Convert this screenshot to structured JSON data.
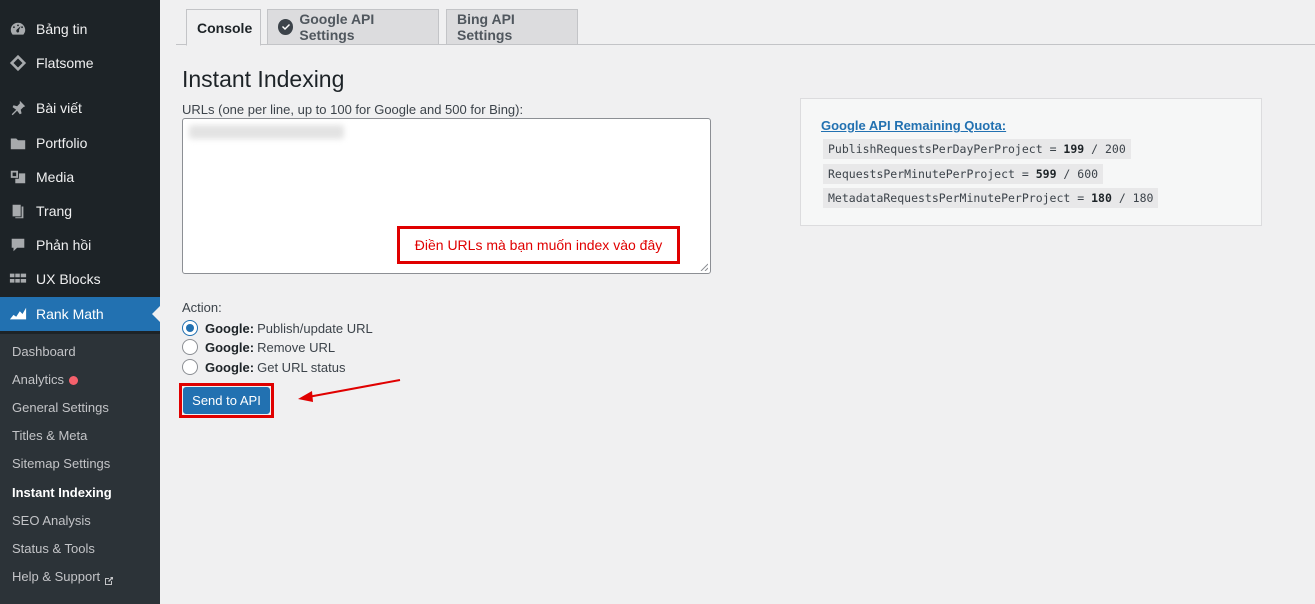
{
  "sidebar": {
    "items": [
      {
        "label": "Bảng tin",
        "icon": "dashboard-icon"
      },
      {
        "label": "Flatsome",
        "icon": "flatsome-icon"
      },
      {
        "label": "Bài viết",
        "icon": "pin-icon"
      },
      {
        "label": "Portfolio",
        "icon": "portfolio-icon"
      },
      {
        "label": "Media",
        "icon": "media-icon"
      },
      {
        "label": "Trang",
        "icon": "page-icon"
      },
      {
        "label": "Phản hồi",
        "icon": "comments-icon"
      },
      {
        "label": "UX Blocks",
        "icon": "blocks-icon"
      },
      {
        "label": "Rank Math",
        "icon": "rank-math-icon"
      }
    ],
    "submenu": [
      {
        "label": "Dashboard"
      },
      {
        "label": "Analytics"
      },
      {
        "label": "General Settings"
      },
      {
        "label": "Titles & Meta"
      },
      {
        "label": "Sitemap Settings"
      },
      {
        "label": "Instant Indexing"
      },
      {
        "label": "SEO Analysis"
      },
      {
        "label": "Status & Tools"
      },
      {
        "label": "Help & Support"
      }
    ],
    "active_color": "#2271b1"
  },
  "tabs": [
    {
      "label": "Console"
    },
    {
      "label": "Google API Settings"
    },
    {
      "label": "Bing API Settings"
    }
  ],
  "main": {
    "title": "Instant Indexing",
    "urls_label": "URLs (one per line, up to 100 for Google and 500 for Bing):",
    "annotation": "Điền URLs mà bạn muốn index vào đây",
    "action_label": "Action:",
    "actions": [
      {
        "engine": "Google:",
        "label": "Publish/update URL",
        "checked": true
      },
      {
        "engine": "Google:",
        "label": "Remove URL",
        "checked": false
      },
      {
        "engine": "Google:",
        "label": "Get URL status",
        "checked": false
      }
    ],
    "send_button": "Send to API"
  },
  "quota": {
    "title": "Google API Remaining Quota:",
    "rows": [
      {
        "name": "PublishRequestsPerDayPerProject",
        "remaining": "199",
        "limit": "200"
      },
      {
        "name": "RequestsPerMinutePerProject",
        "remaining": "599",
        "limit": "600"
      },
      {
        "name": "MetadataRequestsPerMinutePerProject",
        "remaining": "180",
        "limit": "180"
      }
    ]
  }
}
